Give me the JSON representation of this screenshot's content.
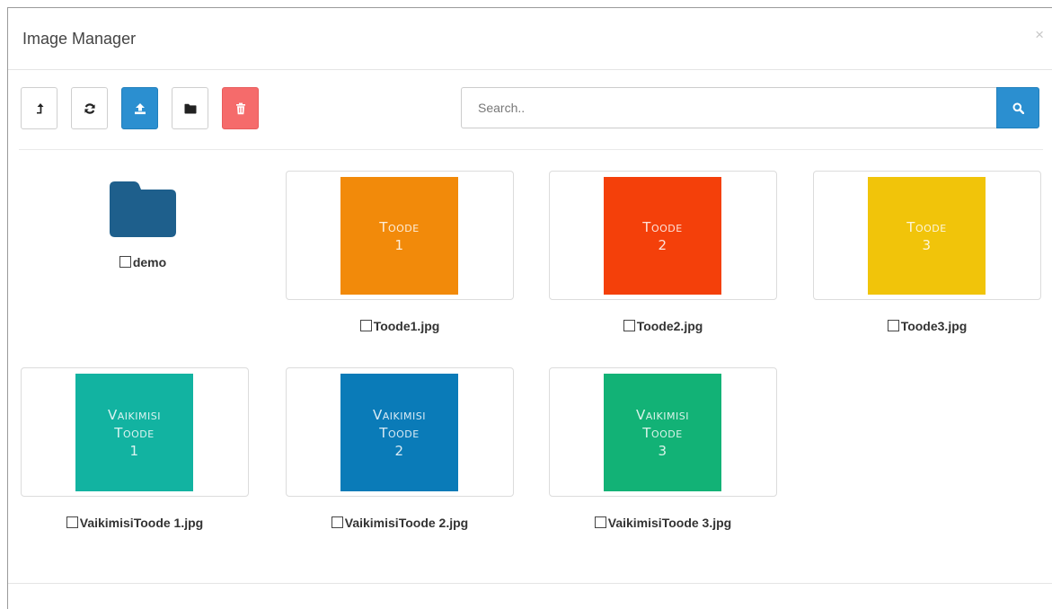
{
  "modal": {
    "title": "Image Manager",
    "close_glyph": "×"
  },
  "toolbar": {
    "buttons": [
      {
        "icon": "level-up-icon",
        "color": "#ffffff"
      },
      {
        "icon": "refresh-icon",
        "color": "#ffffff"
      },
      {
        "icon": "upload-icon",
        "color": "#2b8fd0"
      },
      {
        "icon": "folder-icon",
        "color": "#ffffff"
      },
      {
        "icon": "trash-icon",
        "color": "#f56b6b"
      }
    ]
  },
  "search": {
    "placeholder": "Search..",
    "value": "",
    "button_icon": "search-icon"
  },
  "folders": [
    {
      "name": "demo",
      "color": "#1e5f8c"
    }
  ],
  "images": [
    {
      "filename": "Toode1.jpg",
      "thumb_text": "Toode\n1",
      "color": "#f28a0a"
    },
    {
      "filename": "Toode2.jpg",
      "thumb_text": "Toode\n2",
      "color": "#f4400a"
    },
    {
      "filename": "Toode3.jpg",
      "thumb_text": "Toode\n3",
      "color": "#f1c40a"
    },
    {
      "filename": "VaikimisiToode 1.jpg",
      "thumb_text": "Vaikimisi\nToode\n1",
      "color": "#12b3a1"
    },
    {
      "filename": "VaikimisiToode 2.jpg",
      "thumb_text": "Vaikimisi\nToode\n2",
      "color": "#0a7bb8"
    },
    {
      "filename": "VaikimisiToode 3.jpg",
      "thumb_text": "Vaikimisi\nToode\n3",
      "color": "#12b276"
    }
  ]
}
